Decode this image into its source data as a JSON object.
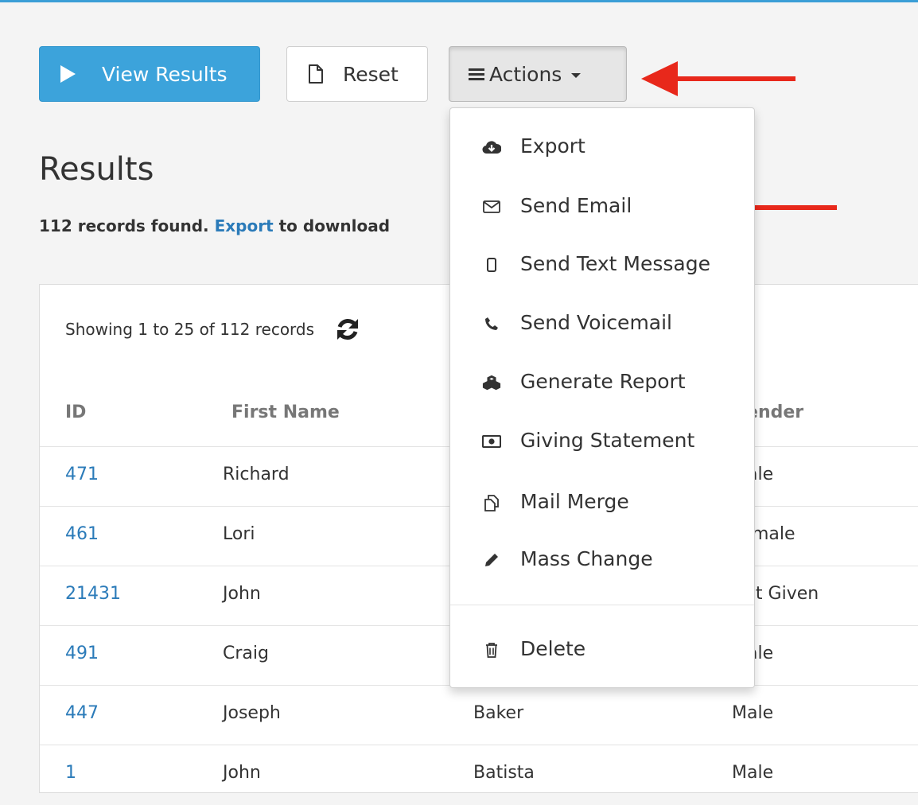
{
  "toolbar": {
    "view_results_label": "View Results",
    "reset_label": "Reset",
    "actions_label": "Actions"
  },
  "results": {
    "title": "Results",
    "summary_count": "112 records found.",
    "summary_link": "Export",
    "summary_rest": "to download"
  },
  "table": {
    "showing": "Showing 1 to 25 of 112 records",
    "headers": {
      "id": "ID",
      "first_name": "First Name",
      "gender": "Gender"
    },
    "rows": [
      {
        "id": "471",
        "first_name": "Richard",
        "last_name": "",
        "gender": "Male"
      },
      {
        "id": "461",
        "first_name": "Lori",
        "last_name": "",
        "gender": "Female"
      },
      {
        "id": "21431",
        "first_name": "John",
        "last_name": "",
        "gender": "Not Given"
      },
      {
        "id": "491",
        "first_name": "Craig",
        "last_name": "",
        "gender": "Male"
      },
      {
        "id": "447",
        "first_name": "Joseph",
        "last_name": "Baker",
        "gender": "Male"
      },
      {
        "id": "1",
        "first_name": "John",
        "last_name": "Batista",
        "gender": "Male"
      }
    ]
  },
  "actions_menu": {
    "items": [
      {
        "label": "Export",
        "icon": "cloud-download-icon"
      },
      {
        "label": "Send Email",
        "icon": "envelope-icon"
      },
      {
        "label": "Send Text Message",
        "icon": "mobile-phone-icon"
      },
      {
        "label": "Send Voicemail",
        "icon": "phone-icon"
      },
      {
        "label": "Generate Report",
        "icon": "cubes-icon"
      },
      {
        "label": "Giving Statement",
        "icon": "money-icon"
      },
      {
        "label": "Mail Merge",
        "icon": "copy-icon"
      },
      {
        "label": "Mass Change",
        "icon": "pencil-icon"
      },
      {
        "label": "Delete",
        "icon": "trash-icon"
      }
    ]
  },
  "annotations": {
    "arrow_color": "#e8281b",
    "arrow_targets": [
      "actions-button",
      "send-email-item"
    ]
  },
  "colors": {
    "primary": "#3ca3db",
    "link": "#2b7bb9",
    "top_rule": "#3a9ed6"
  }
}
